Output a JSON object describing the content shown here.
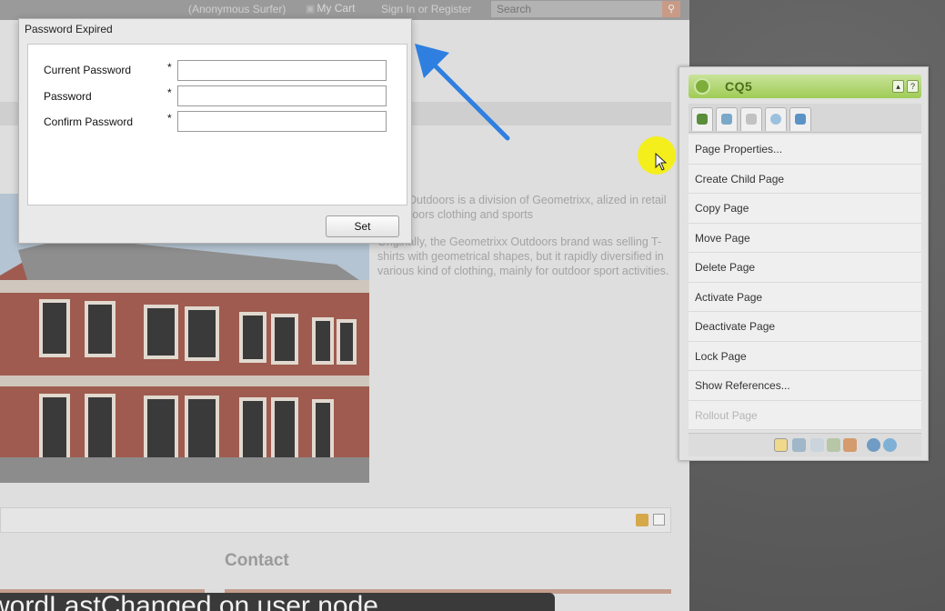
{
  "site": {
    "topbar": {
      "user": "(Anonymous Surfer)",
      "cart": "My Cart",
      "signin": "Sign In or Register",
      "search_placeholder": "Search"
    },
    "about": {
      "paragraph1": "etrixx Outdoors is a division of Geometrixx, alized in retail of outdoors clothing and sports",
      "paragraph2": "Originally, the Geometrixx Outdoors brand was selling T-shirts with geometrical shapes, but it rapidly diversified in various kind of clothing, mainly for outdoor sport activities."
    },
    "contact_heading": "Contact"
  },
  "dialog": {
    "title": "Password Expired",
    "fields": [
      {
        "label": "Current Password",
        "required": "*",
        "value": ""
      },
      {
        "label": "Password",
        "required": "*",
        "value": ""
      },
      {
        "label": "Confirm Password",
        "required": "*",
        "value": ""
      }
    ],
    "set_label": "Set"
  },
  "sidekick": {
    "title": "CQ5",
    "menu": [
      {
        "label": "Page Properties...",
        "enabled": true
      },
      {
        "label": "Create Child Page",
        "enabled": true
      },
      {
        "label": "Copy Page",
        "enabled": true
      },
      {
        "label": "Move Page",
        "enabled": true
      },
      {
        "label": "Delete Page",
        "enabled": true
      },
      {
        "label": "Activate Page",
        "enabled": true
      },
      {
        "label": "Deactivate Page",
        "enabled": true
      },
      {
        "label": "Lock Page",
        "enabled": true
      },
      {
        "label": "Show References...",
        "enabled": true
      },
      {
        "label": "Rollout Page",
        "enabled": false
      }
    ]
  },
  "caption": "swordLastChanged on user node",
  "colors": {
    "arrow": "#2f7fe0",
    "cursor_highlight": "#f4ef1c",
    "sidekick_header": "#9fcc55"
  }
}
